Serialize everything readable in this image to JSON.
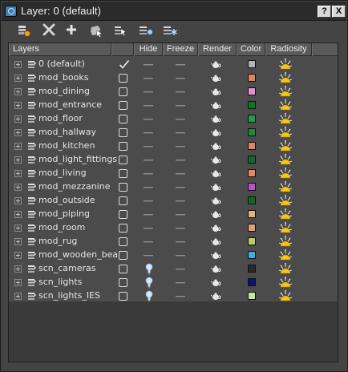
{
  "window": {
    "title": "Layer: 0 (default)",
    "help_label": "?",
    "close_label": "X"
  },
  "toolbar": {
    "tools": [
      {
        "name": "create-new-layer-icon"
      },
      {
        "name": "delete-layer-icon"
      },
      {
        "name": "add-selection-to-layer-icon"
      },
      {
        "name": "select-objects-in-layer-icon"
      },
      {
        "name": "highlight-selected-layers-icon"
      },
      {
        "name": "hide-all-layers-icon"
      },
      {
        "name": "freeze-all-layers-icon"
      }
    ]
  },
  "columns": {
    "layers": "Layers",
    "hide": "Hide",
    "freeze": "Freeze",
    "render": "Render",
    "color": "Color",
    "radiosity": "Radiosity"
  },
  "layers": [
    {
      "name": "0 (default)",
      "current": true,
      "hide_icon": "dash",
      "color": "#b4b4b4"
    },
    {
      "name": "mod_books",
      "current": false,
      "hide_icon": "dash",
      "color": "#e0845a"
    },
    {
      "name": "mod_dining",
      "current": false,
      "hide_icon": "dash",
      "color": "#e68fd6"
    },
    {
      "name": "mod_entrance",
      "current": false,
      "hide_icon": "dash",
      "color": "#0a7a17"
    },
    {
      "name": "mod_floor",
      "current": false,
      "hide_icon": "dash",
      "color": "#1e9e4a"
    },
    {
      "name": "mod_hallway",
      "current": false,
      "hide_icon": "dash",
      "color": "#1c8a3a"
    },
    {
      "name": "mod_kitchen",
      "current": false,
      "hide_icon": "dash",
      "color": "#e0845a"
    },
    {
      "name": "mod_light_fittings",
      "current": false,
      "hide_icon": "dash",
      "color": "#0e6a2a"
    },
    {
      "name": "mod_living",
      "current": false,
      "hide_icon": "dash",
      "color": "#e58a5c"
    },
    {
      "name": "mod_mezzanine",
      "current": false,
      "hide_icon": "dash",
      "color": "#c04ad6"
    },
    {
      "name": "mod_outside",
      "current": false,
      "hide_icon": "dash",
      "color": "#0c6a1c"
    },
    {
      "name": "mod_piping",
      "current": false,
      "hide_icon": "dash",
      "color": "#e6b080"
    },
    {
      "name": "mod_room",
      "current": false,
      "hide_icon": "dash",
      "color": "#e89a7a"
    },
    {
      "name": "mod_rug",
      "current": false,
      "hide_icon": "dash",
      "color": "#b8d060"
    },
    {
      "name": "mod_wooden_beam",
      "current": false,
      "hide_icon": "dash",
      "color": "#3ab0e0"
    },
    {
      "name": "scn_cameras",
      "current": false,
      "hide_icon": "bulb",
      "color": "#2a2a2a"
    },
    {
      "name": "scn_lights",
      "current": false,
      "hide_icon": "bulb",
      "color": "#10107a"
    },
    {
      "name": "scn_lights_IES",
      "current": false,
      "hide_icon": "bulb",
      "color": "#c0e8a0"
    }
  ]
}
